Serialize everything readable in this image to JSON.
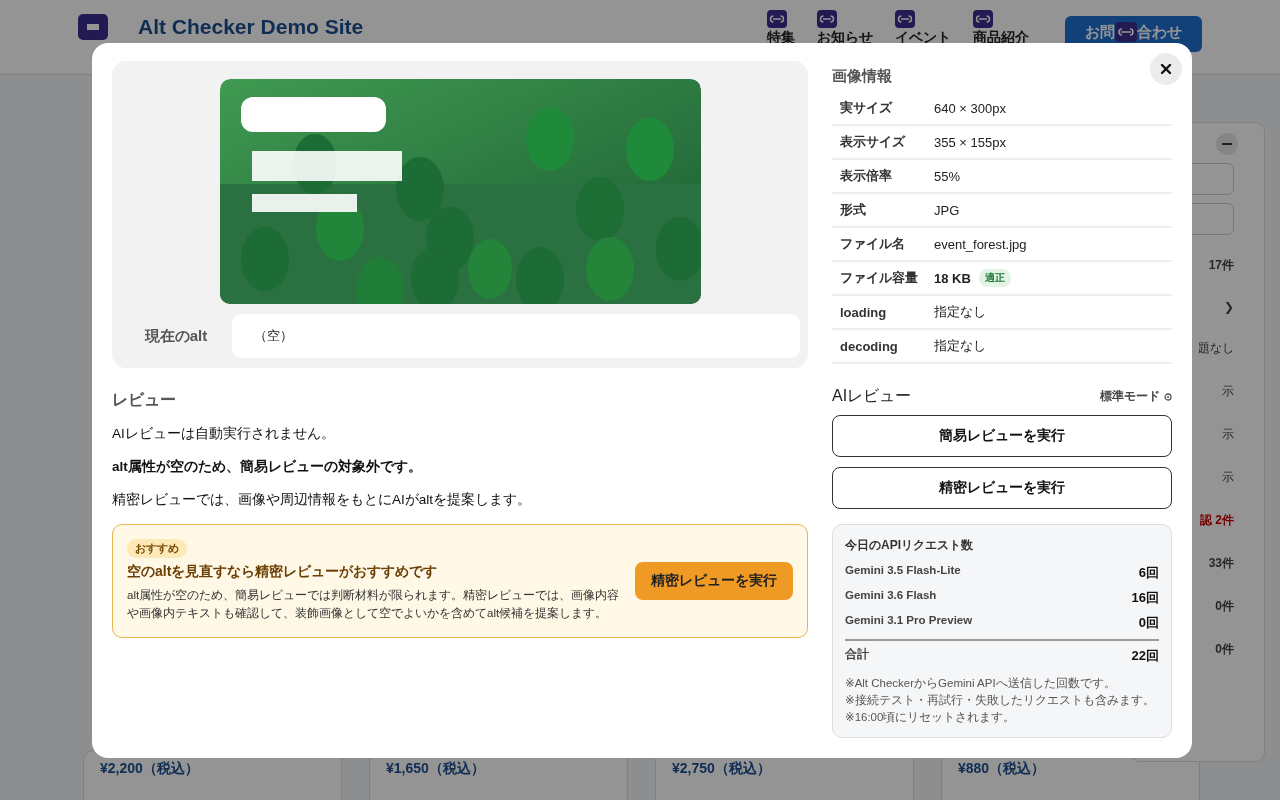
{
  "site": {
    "title": "Alt Checker Demo Site",
    "nav": [
      "特集",
      "お知らせ",
      "イベント",
      "商品紹介"
    ],
    "contact_parts": [
      "お問",
      "合わせ"
    ]
  },
  "products": [
    {
      "price": "¥2,200（税込）"
    },
    {
      "price": "¥1,650（税込）"
    },
    {
      "price": "¥2,750（税込）"
    },
    {
      "price": "¥880（税込）"
    }
  ],
  "side_panel": {
    "items": [
      {
        "text": "17件",
        "kind": "count"
      },
      {
        "text": "❯",
        "kind": "arrow"
      },
      {
        "text": "題なし",
        "kind": "note"
      },
      {
        "text": "示",
        "kind": "note"
      },
      {
        "text": "示",
        "kind": "note"
      },
      {
        "text": "示",
        "kind": "note"
      },
      {
        "text": "認 2件",
        "kind": "alert"
      },
      {
        "text": "33件",
        "kind": "count"
      },
      {
        "text": "0件",
        "kind": "count"
      },
      {
        "text": "0件",
        "kind": "count"
      }
    ]
  },
  "modal": {
    "preview": {
      "alt_label": "現在のalt",
      "alt_value": "（空）"
    },
    "review": {
      "heading": "レビュー",
      "paragraphs": [
        {
          "text": "AIレビューは自動実行されません。",
          "bold": false
        },
        {
          "text": "alt属性が空のため、簡易レビューの対象外です。",
          "bold": true
        },
        {
          "text": "精密レビューでは、画像や周辺情報をもとにAIがaltを提案します。",
          "bold": false
        }
      ],
      "recommend": {
        "badge": "おすすめ",
        "title": "空のaltを見直すなら精密レビューがおすすめです",
        "description": "alt属性が空のため、簡易レビューでは判断材料が限られます。精密レビューでは、画像内容や画像内テキストも確認して、装飾画像として空でよいかを含めてalt候補を提案します。",
        "button": "精密レビューを実行"
      }
    },
    "image_info": {
      "heading": "画像情報",
      "rows": [
        {
          "label": "実サイズ",
          "value": "640 × 300px",
          "bold": false
        },
        {
          "label": "表示サイズ",
          "value": "355 × 155px",
          "bold": false
        },
        {
          "label": "表示倍率",
          "value": "55%",
          "bold": false
        },
        {
          "label": "形式",
          "value": "JPG",
          "bold": false
        },
        {
          "label": "ファイル名",
          "value": "event_forest.jpg",
          "bold": false
        },
        {
          "label": "ファイル容量",
          "value": "18 KB",
          "bold": true,
          "badge": "適正"
        },
        {
          "label": "loading",
          "value": "指定なし",
          "bold": false
        },
        {
          "label": "decoding",
          "value": "指定なし",
          "bold": false
        }
      ]
    },
    "ai_review": {
      "heading": "AIレビュー",
      "mode": "標準モード",
      "buttons": [
        "簡易レビューを実行",
        "精密レビューを実行"
      ]
    },
    "api_usage": {
      "title": "今日のAPIリクエスト数",
      "rows": [
        {
          "model": "Gemini 3.5 Flash-Lite",
          "count": "6回"
        },
        {
          "model": "Gemini 3.6 Flash",
          "count": "16回"
        },
        {
          "model": "Gemini 3.1 Pro Preview",
          "count": "0回"
        }
      ],
      "total_label": "合計",
      "total": "22回",
      "notes": [
        "※Alt CheckerからGemini APIへ送信した回数です。",
        "※接続テスト・再試行・失敗したリクエストも含みます。",
        "※16:00頃にリセットされます。"
      ]
    }
  }
}
